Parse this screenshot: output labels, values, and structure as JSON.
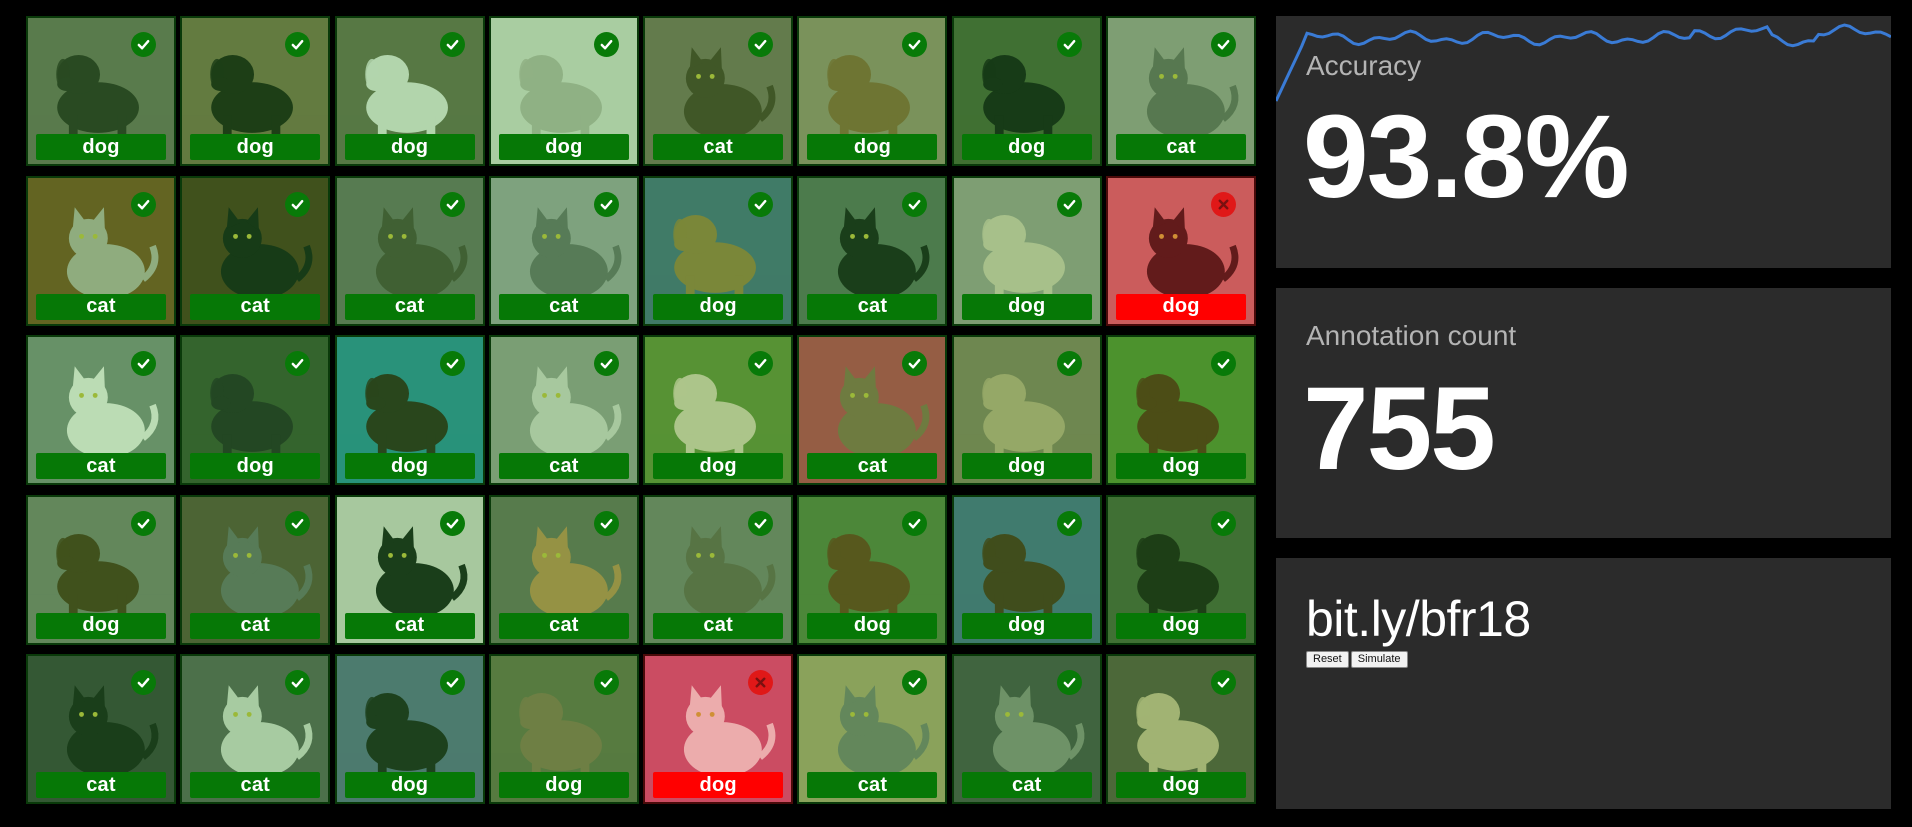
{
  "accuracy": {
    "label": "Accuracy",
    "value": "93.8%",
    "history_color": "#3a7bd5"
  },
  "annotation_count": {
    "label": "Annotation count",
    "value": "755"
  },
  "link": {
    "text": "bit.ly/bfr18"
  },
  "buttons": {
    "reset_label": "Reset",
    "simulate_label": "Simulate"
  },
  "colors": {
    "correct": "#067806",
    "wrong": "#ff0000",
    "panel": "#2b2b2b"
  },
  "tiles": [
    {
      "label": "dog",
      "correct": true,
      "photo": "dog",
      "bg": "#6d6a5a",
      "fg": "#2a2620"
    },
    {
      "label": "dog",
      "correct": true,
      "photo": "dog",
      "bg": "#7a6a4a",
      "fg": "#191510"
    },
    {
      "label": "dog",
      "correct": true,
      "photo": "dog",
      "bg": "#6a6650",
      "fg": "#e8e6e0"
    },
    {
      "label": "dog",
      "correct": true,
      "photo": "dog",
      "bg": "#dcdcd0",
      "fg": "#b8b4a8"
    },
    {
      "label": "cat",
      "correct": true,
      "photo": "cat",
      "bg": "#7a6a5a",
      "fg": "#4a3828"
    },
    {
      "label": "dog",
      "correct": true,
      "photo": "dog",
      "bg": "#9a8a70",
      "fg": "#8a6238"
    },
    {
      "label": "dog",
      "correct": true,
      "photo": "dog",
      "bg": "#4a5a38",
      "fg": "#111111"
    },
    {
      "label": "cat",
      "correct": true,
      "photo": "cat",
      "bg": "#a09a90",
      "fg": "#6a6660"
    },
    {
      "label": "cat",
      "correct": true,
      "photo": "cat",
      "bg": "#7a4a20",
      "fg": "#b8aea0"
    },
    {
      "label": "cat",
      "correct": true,
      "photo": "cat",
      "bg": "#4a3018",
      "fg": "#111111"
    },
    {
      "label": "cat",
      "correct": true,
      "photo": "cat",
      "bg": "#6a6a62",
      "fg": "#4a4438"
    },
    {
      "label": "cat",
      "correct": true,
      "photo": "cat",
      "bg": "#a0a0a0",
      "fg": "#6a6a6a"
    },
    {
      "label": "dog",
      "correct": true,
      "photo": "dog",
      "bg": "#4a6a80",
      "fg": "#9a7a40"
    },
    {
      "label": "cat",
      "correct": true,
      "photo": "cat",
      "bg": "#5a6a5a",
      "fg": "#151515"
    },
    {
      "label": "dog",
      "correct": true,
      "photo": "dog",
      "bg": "#a09a90",
      "fg": "#d8cab0"
    },
    {
      "label": "dog",
      "correct": false,
      "photo": "cat",
      "bg": "#c07878",
      "fg": "#2a1a1a"
    },
    {
      "label": "cat",
      "correct": true,
      "photo": "cat",
      "bg": "#808880",
      "fg": "#f4f0ea"
    },
    {
      "label": "dog",
      "correct": true,
      "photo": "dog",
      "bg": "#3a4a30",
      "fg": "#222222"
    },
    {
      "label": "dog",
      "correct": true,
      "photo": "dog",
      "bg": "#2a8a9a",
      "fg": "#2a2018"
    },
    {
      "label": "cat",
      "correct": true,
      "photo": "cat",
      "bg": "#9a9a92",
      "fg": "#d8d4cc"
    },
    {
      "label": "dog",
      "correct": true,
      "photo": "dog",
      "bg": "#6a8a3a",
      "fg": "#e0d0b0"
    },
    {
      "label": "cat",
      "correct": true,
      "photo": "cat",
      "bg": "#c04050",
      "fg": "#8a6a4a"
    },
    {
      "label": "dog",
      "correct": true,
      "photo": "dog",
      "bg": "#8a7a60",
      "fg": "#c0a880"
    },
    {
      "label": "dog",
      "correct": true,
      "photo": "dog",
      "bg": "#5a8a30",
      "fg": "#5a2a10"
    },
    {
      "label": "dog",
      "correct": true,
      "photo": "dog",
      "bg": "#7a7a70",
      "fg": "#4a3018"
    },
    {
      "label": "cat",
      "correct": true,
      "photo": "cat",
      "bg": "#5a4a3a",
      "fg": "#6a6a6a"
    },
    {
      "label": "cat",
      "correct": true,
      "photo": "cat",
      "bg": "#d8d4cc",
      "fg": "#151515"
    },
    {
      "label": "cat",
      "correct": true,
      "photo": "cat",
      "bg": "#6a6a5a",
      "fg": "#c08a50"
    },
    {
      "label": "cat",
      "correct": true,
      "photo": "cat",
      "bg": "#7a7a70",
      "fg": "#6a6050"
    },
    {
      "label": "dog",
      "correct": true,
      "photo": "dog",
      "bg": "#5a7a40",
      "fg": "#6a3a1a"
    },
    {
      "label": "dog",
      "correct": true,
      "photo": "dog",
      "bg": "#4a6a8a",
      "fg": "#4a2a18"
    },
    {
      "label": "dog",
      "correct": true,
      "photo": "dog",
      "bg": "#4a5a3a",
      "fg": "#1a1510"
    },
    {
      "label": "cat",
      "correct": true,
      "photo": "cat",
      "bg": "#3a3a3a",
      "fg": "#151515"
    },
    {
      "label": "cat",
      "correct": true,
      "photo": "cat",
      "bg": "#5a5a58",
      "fg": "#d8d8d0"
    },
    {
      "label": "dog",
      "correct": true,
      "photo": "dog",
      "bg": "#5a6a8a",
      "fg": "#1a1a1a"
    },
    {
      "label": "dog",
      "correct": true,
      "photo": "dog",
      "bg": "#6a6a4a",
      "fg": "#8a7050"
    },
    {
      "label": "dog",
      "correct": false,
      "photo": "cat",
      "bg": "#c06080",
      "fg": "#f0eaea"
    },
    {
      "label": "cat",
      "correct": true,
      "photo": "cat",
      "bg": "#b0a070",
      "fg": "#7a7a70"
    },
    {
      "label": "cat",
      "correct": true,
      "photo": "cat",
      "bg": "#4a4a48",
      "fg": "#8a8a80"
    },
    {
      "label": "dog",
      "correct": true,
      "photo": "dog",
      "bg": "#5a5040",
      "fg": "#d0b890"
    }
  ]
}
